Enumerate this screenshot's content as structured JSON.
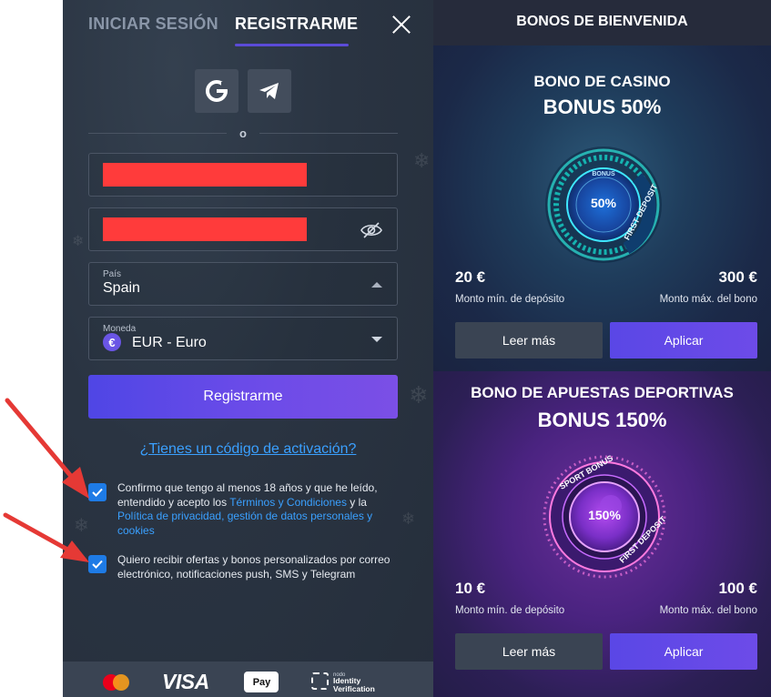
{
  "auth": {
    "tabs": [
      {
        "label": "INICIAR SESIÓN",
        "active": false
      },
      {
        "label": "REGISTRARME",
        "active": true
      }
    ],
    "or_label": "o",
    "country": {
      "label": "País",
      "value": "Spain"
    },
    "currency": {
      "label": "Moneda",
      "symbol": "€",
      "value": "EUR - Euro"
    },
    "register_label": "Registrarme",
    "promo_link": "¿Tienes un código de activación?",
    "consent_age": {
      "text_1": "Confirmo que tengo al menos 18 años y que he leído, entendido y acepto los ",
      "link_terms": "Términos y Condiciones",
      "text_2": " y la ",
      "link_privacy": "Política de privacidad, gestión de datos personales y cookies",
      "checked": true
    },
    "consent_marketing": {
      "text": "Quiero recibir ofertas y bonos personalizados por correo electrónico, notificaciones push, SMS y Telegram",
      "checked": true
    },
    "footer": {
      "visa": "VISA",
      "applepay": "Pay",
      "idv_small": "nodo",
      "idv_line1": "Identity",
      "idv_line2": "Verification"
    }
  },
  "bonuses": {
    "title": "BONOS DE BIENVENIDA",
    "cards": [
      {
        "name": "BONO DE CASINO",
        "bonus": "BONUS 50%",
        "badge_percent": "50%",
        "badge_top": "BONUS",
        "badge_ring": "FIRST DEPOSIT",
        "min_amount": "20 €",
        "min_label": "Monto mín. de depósito",
        "max_amount": "300 €",
        "max_label": "Monto máx. del bono",
        "read_more": "Leer más",
        "apply": "Aplicar"
      },
      {
        "name": "BONO DE APUESTAS DEPORTIVAS",
        "bonus": "BONUS 150%",
        "badge_percent": "150%",
        "badge_top": "SPORT BONUS",
        "badge_ring": "FIRST DEPOSIT",
        "min_amount": "10 €",
        "min_label": "Monto mín. de depósito",
        "max_amount": "100 €",
        "max_label": "Monto máx. del bono",
        "read_more": "Leer más",
        "apply": "Aplicar"
      }
    ]
  },
  "colors": {
    "accent": "#5b4bd8",
    "link": "#3aa0ff",
    "checkbox": "#1e7be6",
    "redaction": "#ff3b3b",
    "annotation_arrow": "#e53935"
  }
}
